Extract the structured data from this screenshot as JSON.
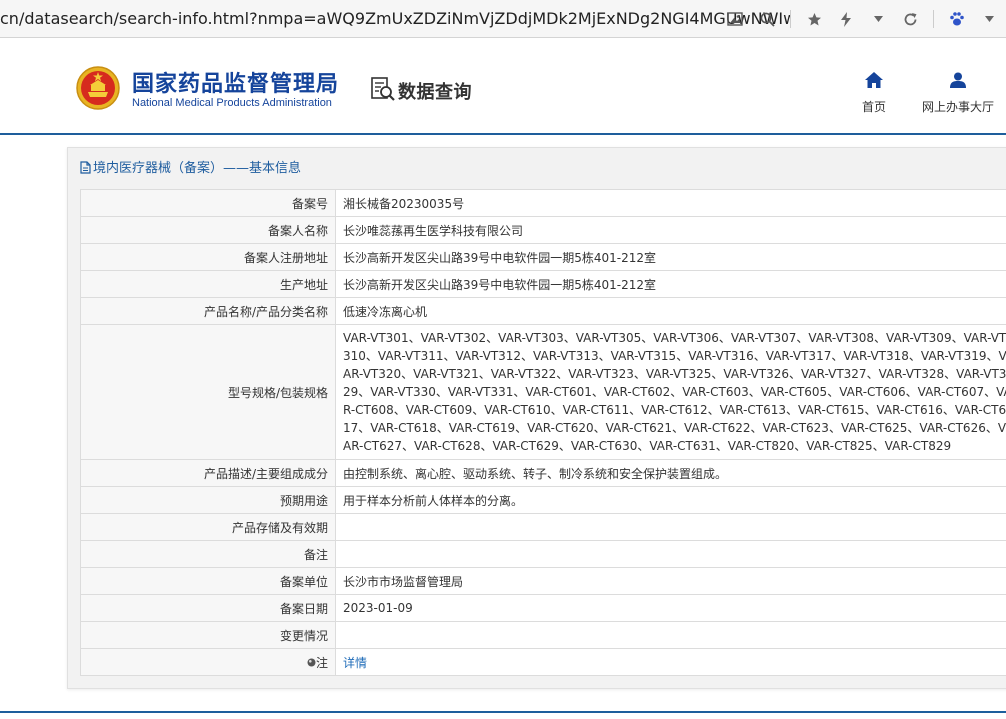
{
  "browser": {
    "url": "cn/datasearch/search-info.html?nmpa=aWQ9ZmUxZDZiNmVjZDdjMDk2MjExNDg2NGI4MGUwNWIwODImaXRlbUlkP..."
  },
  "header": {
    "agency_cn": "国家药品监督管理局",
    "agency_en": "National Medical Products Administration",
    "section": "数据查询",
    "nav_home": "首页",
    "nav_hall": "网上办事大厅"
  },
  "panel": {
    "title": "境内医疗器械（备案）——基本信息"
  },
  "rows": [
    {
      "label": "备案号",
      "value": "湘长械备20230035号"
    },
    {
      "label": "备案人名称",
      "value": "长沙唯蕊蓀再生医学科技有限公司"
    },
    {
      "label": "备案人注册地址",
      "value": "长沙高新开发区尖山路39号中电软件园一期5栋401-212室"
    },
    {
      "label": "生产地址",
      "value": "长沙高新开发区尖山路39号中电软件园一期5栋401-212室"
    },
    {
      "label": "产品名称/产品分类名称",
      "value": "低速冷冻离心机"
    },
    {
      "label": "型号规格/包装规格",
      "value": "VAR-VT301、VAR-VT302、VAR-VT303、VAR-VT305、VAR-VT306、VAR-VT307、VAR-VT308、VAR-VT309、VAR-VT310、VAR-VT311、VAR-VT312、VAR-VT313、VAR-VT315、VAR-VT316、VAR-VT317、VAR-VT318、VAR-VT319、VAR-VT320、VAR-VT321、VAR-VT322、VAR-VT323、VAR-VT325、VAR-VT326、VAR-VT327、VAR-VT328、VAR-VT329、VAR-VT330、VAR-VT331、VAR-CT601、VAR-CT602、VAR-CT603、VAR-CT605、VAR-CT606、VAR-CT607、VAR-CT608、VAR-CT609、VAR-CT610、VAR-CT611、VAR-CT612、VAR-CT613、VAR-CT615、VAR-CT616、VAR-CT617、VAR-CT618、VAR-CT619、VAR-CT620、VAR-CT621、VAR-CT622、VAR-CT623、VAR-CT625、VAR-CT626、VAR-CT627、VAR-CT628、VAR-CT629、VAR-CT630、VAR-CT631、VAR-CT820、VAR-CT825、VAR-CT829"
    },
    {
      "label": "产品描述/主要组成成分",
      "value": "由控制系统、离心腔、驱动系统、转子、制冷系统和安全保护装置组成。"
    },
    {
      "label": "预期用途",
      "value": "用于样本分析前人体样本的分离。"
    },
    {
      "label": "产品存储及有效期",
      "value": ""
    },
    {
      "label": "备注",
      "value": ""
    },
    {
      "label": "备案单位",
      "value": "长沙市市场监督管理局"
    },
    {
      "label": "备案日期",
      "value": "2023-01-09"
    },
    {
      "label": "变更情况",
      "value": ""
    }
  ],
  "note": {
    "label": "注",
    "link": "详情"
  },
  "icons": {
    "emblem": "national-emblem-icon",
    "search": "data-search-icon",
    "home": "home-icon",
    "user": "user-icon",
    "note": "note-bullet-icon",
    "doc": "document-icon"
  },
  "colors": {
    "brand": "#15449b",
    "rule": "#1e5e9c",
    "link": "#1e6bb8"
  }
}
